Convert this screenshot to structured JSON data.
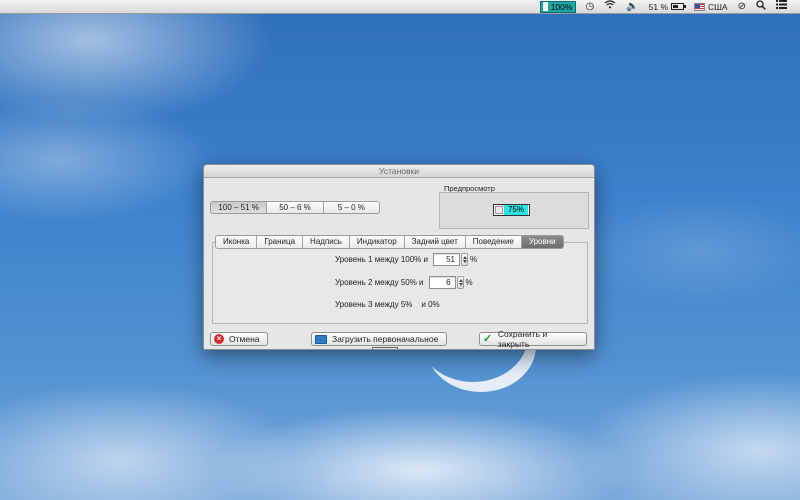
{
  "menubar": {
    "battery_percent_box": "100%",
    "battery_percent": "51 %",
    "input_language": "США",
    "icons": [
      "time-machine-icon",
      "wifi-icon",
      "volume-icon",
      "battery-icon",
      "flag-us-icon",
      "sync-icon",
      "spotlight-icon",
      "list-icon"
    ]
  },
  "window": {
    "title": "Установки",
    "ranges": [
      {
        "label": "100 – 51 %",
        "active": true
      },
      {
        "label": "50 – 6 %",
        "active": false
      },
      {
        "label": "5 – 0 %",
        "active": false
      }
    ],
    "preview": {
      "label": "Предпросмотр",
      "value": "75%"
    },
    "tabs": [
      {
        "label": "Иконка",
        "active": false
      },
      {
        "label": "Граница",
        "active": false
      },
      {
        "label": "Надпись",
        "active": false
      },
      {
        "label": "Индикатор",
        "active": false
      },
      {
        "label": "Задний цвет",
        "active": false
      },
      {
        "label": "Поведение",
        "active": false
      },
      {
        "label": "Уровни",
        "active": true
      }
    ],
    "levels": {
      "level1": {
        "prefix": "Уровень 1 между 100% и",
        "value": "51",
        "suffix": "%"
      },
      "level2": {
        "prefix": "Уровень 2 между  50%  и",
        "value": "6",
        "suffix": "%"
      },
      "level3": {
        "prefix": "Уровень 3 между  5%",
        "suffix": "и 0%"
      }
    },
    "buttons": {
      "cancel": "Отмена",
      "load_defaults": "Загрузить первоначальное",
      "save_close": "Сохранить и закрыть"
    }
  }
}
